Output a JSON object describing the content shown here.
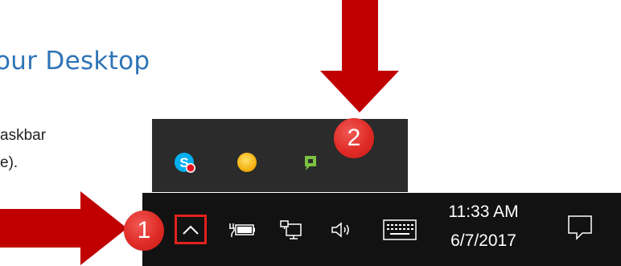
{
  "document": {
    "heading": "our Desktop",
    "lines": [
      "askbar",
      "e)."
    ]
  },
  "overflow_panel": {
    "apps": [
      {
        "name": "skype-icon"
      },
      {
        "name": "yellow-circle-app-icon"
      },
      {
        "name": "green-chat-app-icon"
      }
    ]
  },
  "taskbar": {
    "clock": {
      "time": "11:33 AM",
      "date": "6/7/2017"
    },
    "icons": [
      "chevron-up-icon",
      "power-battery-icon",
      "network-icon",
      "volume-icon",
      "keyboard-icon",
      "action-center-icon"
    ]
  },
  "callouts": [
    {
      "number": "1",
      "target": "show-hidden-icons"
    },
    {
      "number": "2",
      "target": "overflow-panel"
    }
  ],
  "colors": {
    "heading": "#2e74b5",
    "highlight_box": "#e1221d",
    "arrow": "#c00000",
    "badge": "#e02b26",
    "taskbar": "#121212",
    "overflow_panel": "#2b2b2b"
  }
}
